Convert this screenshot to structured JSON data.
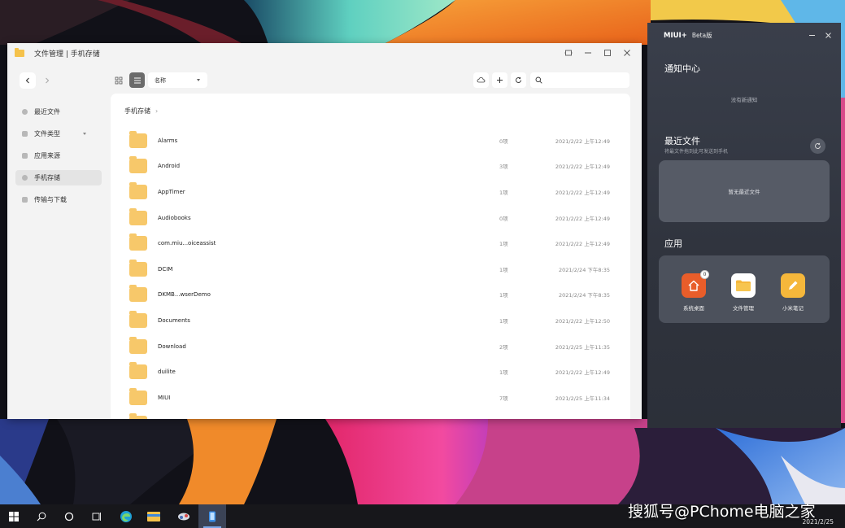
{
  "colors": {
    "folder": "#f7c86a",
    "panel_bg": "#343843",
    "accent_orange": "#e85d2a",
    "accent_yellow": "#f5b73b"
  },
  "file_manager": {
    "title": "文件管理 | 手机存储",
    "sort_label": "名称",
    "search_placeholder": "",
    "breadcrumb": "手机存储",
    "sidebar": [
      {
        "label": "最近文件",
        "icon": "clock-icon"
      },
      {
        "label": "文件类型",
        "icon": "category-icon"
      },
      {
        "label": "应用来源",
        "icon": "app-source-icon"
      },
      {
        "label": "手机存储",
        "icon": "storage-icon"
      },
      {
        "label": "传输与下载",
        "icon": "download-icon"
      }
    ],
    "files": [
      {
        "name": "Alarms",
        "count": "0项",
        "date": "2021/2/22 上午12:49"
      },
      {
        "name": "Android",
        "count": "3项",
        "date": "2021/2/22 上午12:49"
      },
      {
        "name": "AppTimer",
        "count": "1项",
        "date": "2021/2/22 上午12:49"
      },
      {
        "name": "Audiobooks",
        "count": "0项",
        "date": "2021/2/22 上午12:49"
      },
      {
        "name": "com.miu...oiceassist",
        "count": "1项",
        "date": "2021/2/22 上午12:49"
      },
      {
        "name": "DCIM",
        "count": "1项",
        "date": "2021/2/24 下午8:35"
      },
      {
        "name": "DKMB...wserDemo",
        "count": "1项",
        "date": "2021/2/24 下午8:35"
      },
      {
        "name": "Documents",
        "count": "1项",
        "date": "2021/2/22 上午12:50"
      },
      {
        "name": "Download",
        "count": "2项",
        "date": "2021/2/25 上午11:35"
      },
      {
        "name": "duilite",
        "count": "1项",
        "date": "2021/2/22 上午12:49"
      },
      {
        "name": "MIUI",
        "count": "7项",
        "date": "2021/2/25 上午11:34"
      }
    ]
  },
  "panel": {
    "title": "MIUI+",
    "beta": "Beta版",
    "notif_title": "通知中心",
    "no_notif": "没有新通知",
    "recent_title": "最近文件",
    "recent_sub": "将最文件拖到此可发送到手机",
    "recent_empty": "暂无最近文件",
    "apps_title": "应用",
    "apps": [
      {
        "label": "系统桌面",
        "badge": "0",
        "color": "#e85d2a",
        "icon": "home-icon"
      },
      {
        "label": "文件管理",
        "color": "#ffffff",
        "icon": "folder-icon"
      },
      {
        "label": "小米笔记",
        "color": "#f5b73b",
        "icon": "pencil-icon"
      }
    ]
  },
  "taskbar": {
    "date": "2021/2/25"
  },
  "watermark": "搜狐号@PChome电脑之家"
}
